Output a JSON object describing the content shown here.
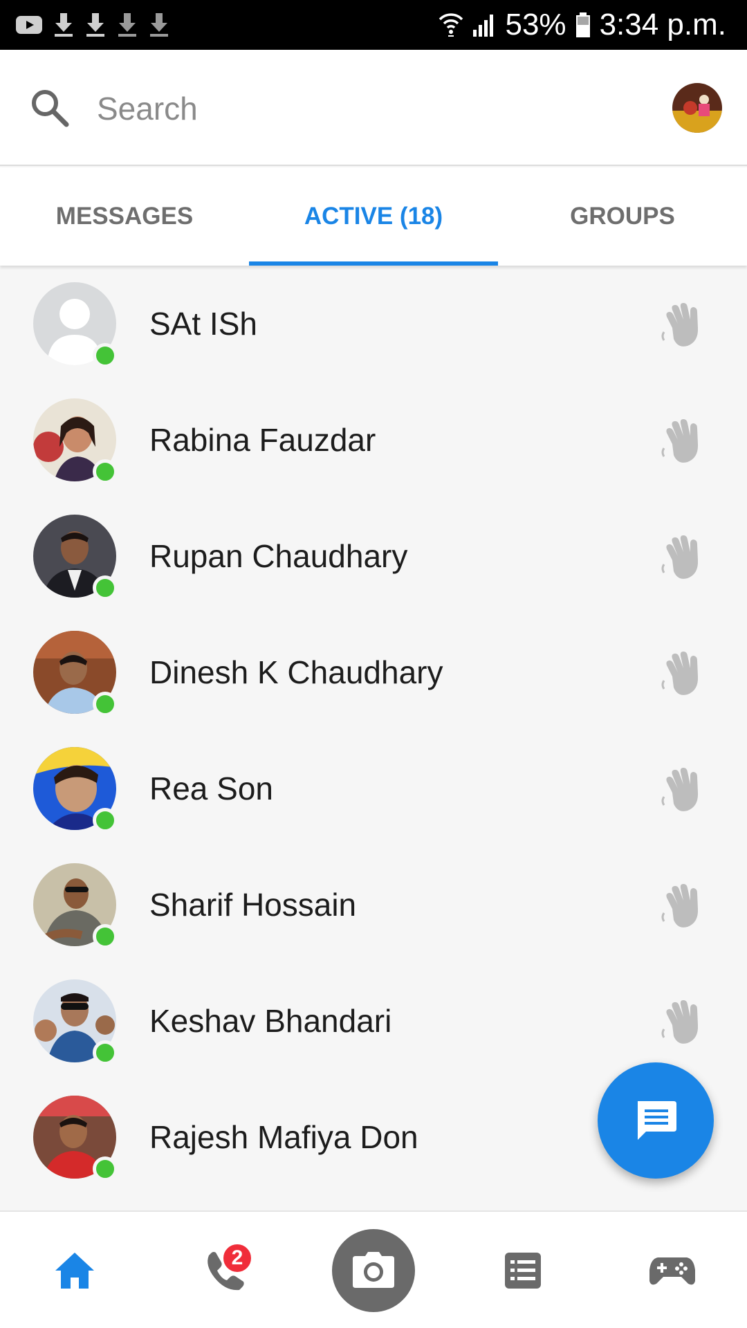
{
  "status_bar": {
    "left_icons": [
      "youtube-icon",
      "download-icon",
      "download-icon",
      "download-icon",
      "download-icon"
    ],
    "right_icons": [
      "wifi-icon",
      "signal-icon",
      "battery-icon"
    ],
    "battery": "53%",
    "time": "3:34 p.m."
  },
  "search": {
    "placeholder": "Search",
    "icon": "search-icon"
  },
  "tabs": [
    {
      "label": "MESSAGES",
      "active": false
    },
    {
      "label": "ACTIVE (18)",
      "active": true
    },
    {
      "label": "GROUPS",
      "active": false
    }
  ],
  "contacts": [
    {
      "name": "SAt ISh",
      "online": true
    },
    {
      "name": "Rabina Fauzdar",
      "online": true
    },
    {
      "name": "Rupan Chaudhary",
      "online": true
    },
    {
      "name": "Dinesh K Chaudhary",
      "online": true
    },
    {
      "name": "Rea Son",
      "online": true
    },
    {
      "name": "Sharif Hossain",
      "online": true
    },
    {
      "name": "Keshav Bhandari",
      "online": true
    },
    {
      "name": "Rajesh Mafiya Don",
      "online": true
    }
  ],
  "bottom_nav": {
    "items": [
      "home-icon",
      "phone-icon",
      "camera-icon",
      "list-icon",
      "game-controller-icon"
    ],
    "calls_badge": "2"
  },
  "colors": {
    "accent": "#1a85e6",
    "online": "#44c337",
    "badge": "#f02d3a",
    "background": "#f6f6f6"
  }
}
